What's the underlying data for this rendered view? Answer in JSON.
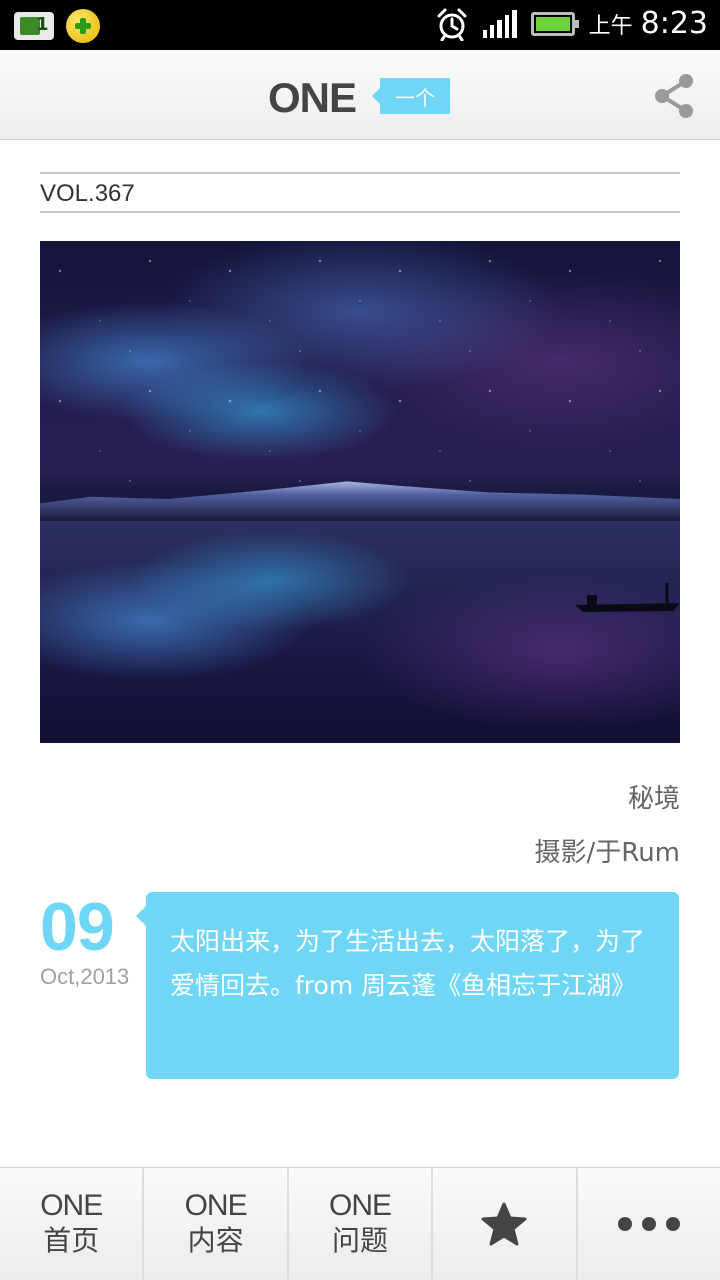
{
  "status_bar": {
    "ampm": "上午",
    "time": "8:23",
    "icons": [
      "app-notification-icon",
      "security-app-icon",
      "alarm-icon",
      "signal-icon",
      "battery-icon"
    ]
  },
  "header": {
    "logo": "ONE",
    "logo_tag": "一个",
    "share_icon": "share-icon"
  },
  "volume": "VOL.367",
  "photo": {
    "title": "秘境",
    "author": "摄影/于Rum"
  },
  "date": {
    "day": "09",
    "month_year": "Oct,2013"
  },
  "quote": "太阳出来，为了生活出去，太阳落了，为了爱情回去。from 周云蓬《鱼相忘于江湖》",
  "nav": {
    "items": [
      {
        "en": "ONE",
        "zh": "首页"
      },
      {
        "en": "ONE",
        "zh": "内容"
      },
      {
        "en": "ONE",
        "zh": "问题"
      }
    ],
    "star_icon": "star-icon",
    "more_icon": "more-icon"
  },
  "colors": {
    "accent": "#6fd6f6",
    "text": "#444444"
  }
}
